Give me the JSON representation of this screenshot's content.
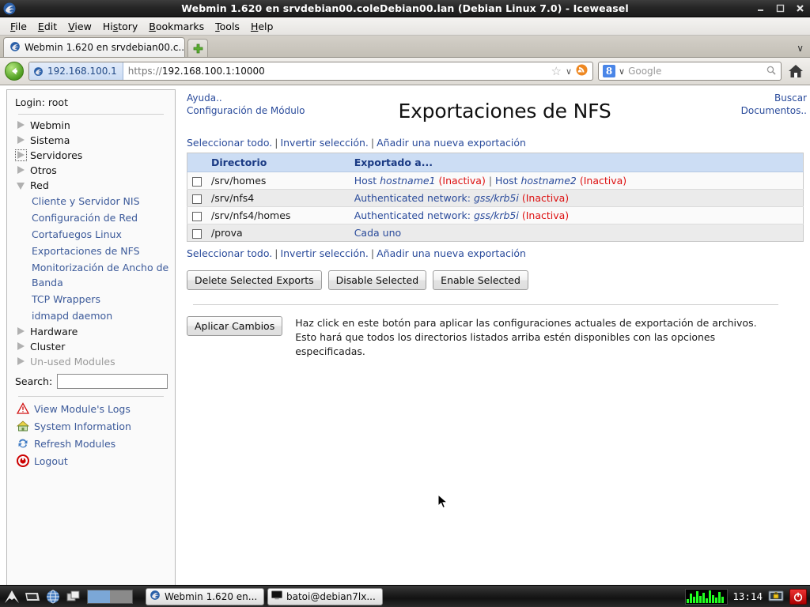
{
  "window": {
    "title": "Webmin 1.620 en srvdebian00.coleDebian00.lan (Debian Linux 7.0) - Iceweasel",
    "icon": "iceweasel-icon",
    "minimize_label": "Minimize",
    "restore_label": "Restore",
    "close_label": "Close"
  },
  "menubar": {
    "items": [
      {
        "label": "File"
      },
      {
        "label": "Edit"
      },
      {
        "label": "View"
      },
      {
        "label": "History"
      },
      {
        "label": "Bookmarks"
      },
      {
        "label": "Tools"
      },
      {
        "label": "Help"
      }
    ]
  },
  "tabs": {
    "items": [
      {
        "title": "Webmin 1.620 en srvdebian00.c..."
      }
    ],
    "new_tab_label": "+",
    "list_all_tabs": "∨"
  },
  "navbar": {
    "back_label": "Back",
    "identity_host": "192.168.100.1",
    "url_scheme": "https://",
    "url_rest": "192.168.100.1:10000",
    "bookmark_star": "☆",
    "dropdown_caret": "∨",
    "search_engine": "8",
    "search_placeholder": "Google",
    "home_label": "Home"
  },
  "sidebar": {
    "login_label": "Login: root",
    "categories": [
      {
        "label": "Webmin",
        "state": "collapsed",
        "focused": false,
        "dim": false
      },
      {
        "label": "Sistema",
        "state": "collapsed",
        "focused": false,
        "dim": false
      },
      {
        "label": "Servidores",
        "state": "collapsed",
        "focused": true,
        "dim": false
      },
      {
        "label": "Otros",
        "state": "collapsed",
        "focused": false,
        "dim": false
      },
      {
        "label": "Red",
        "state": "expanded",
        "focused": false,
        "dim": false
      }
    ],
    "red_modules": [
      {
        "label": "Cliente y Servidor NIS"
      },
      {
        "label": "Configuración de Red"
      },
      {
        "label": "Cortafuegos Linux"
      },
      {
        "label": "Exportaciones de NFS"
      },
      {
        "label": "Monitorización de Ancho de Banda"
      },
      {
        "label": "TCP Wrappers"
      },
      {
        "label": "idmapd daemon"
      }
    ],
    "categories_after": [
      {
        "label": "Hardware",
        "state": "collapsed",
        "dim": false
      },
      {
        "label": "Cluster",
        "state": "collapsed",
        "dim": false
      },
      {
        "label": "Un-used Modules",
        "state": "collapsed",
        "dim": true
      }
    ],
    "search_label": "Search:",
    "search_value": "",
    "actions": [
      {
        "label": "View Module's Logs",
        "icon": "warning-triangle-icon"
      },
      {
        "label": "System Information",
        "icon": "house-icon"
      },
      {
        "label": "Refresh Modules",
        "icon": "refresh-icon"
      },
      {
        "label": "Logout",
        "icon": "power-icon"
      }
    ]
  },
  "main": {
    "help_link": "Ayuda..",
    "module_config_link": "Configuración de Módulo",
    "search_docs_link_line1": "Buscar",
    "search_docs_link_line2": "Documentos..",
    "title": "Exportaciones de NFS",
    "actions": {
      "select_all": "Seleccionar todo.",
      "invert_selection": "Invertir selección.",
      "add_new_export": "Añadir una nueva exportación"
    },
    "table": {
      "headers": [
        "Directorio",
        "Exportado a..."
      ],
      "rows": [
        {
          "checked": false,
          "directory": "/srv/homes",
          "exported_to": [
            {
              "prefix": "Host ",
              "target": "hostname1",
              "status": "(Inactiva)"
            },
            {
              "prefix": "Host ",
              "target": "hostname2",
              "status": "(Inactiva)"
            }
          ]
        },
        {
          "checked": false,
          "directory": "/srv/nfs4",
          "exported_to": [
            {
              "prefix": "Authenticated network: ",
              "target": "gss/krb5i",
              "status": "(Inactiva)"
            }
          ]
        },
        {
          "checked": false,
          "directory": "/srv/nfs4/homes",
          "exported_to": [
            {
              "prefix": "Authenticated network: ",
              "target": "gss/krb5i",
              "status": "(Inactiva)"
            }
          ]
        },
        {
          "checked": false,
          "directory": "/prova",
          "exported_to": [
            {
              "prefix": "Cada uno",
              "target": "",
              "status": ""
            }
          ]
        }
      ]
    },
    "buttons": [
      {
        "label": "Delete Selected Exports"
      },
      {
        "label": "Disable Selected"
      },
      {
        "label": "Enable Selected"
      }
    ],
    "apply_button": "Aplicar Cambios",
    "apply_description": "Haz click en este botón para aplicar las configuraciones actuales de exportación de archivos. Esto hará que todos los directorios listados arriba estén disponibles con las opciones especificadas."
  },
  "taskbar": {
    "launchers": [
      {
        "icon": "show-desktop-icon"
      },
      {
        "icon": "terminal-icon"
      },
      {
        "icon": "browser-globe-icon"
      },
      {
        "icon": "windows-icon"
      }
    ],
    "workspaces": [
      {
        "active": true
      },
      {
        "active": false
      }
    ],
    "tasks": [
      {
        "label": "Webmin 1.620 en...",
        "icon": "iceweasel-icon",
        "active": true
      },
      {
        "label": "batoi@debian7lx...",
        "icon": "terminal-icon",
        "active": false
      }
    ],
    "tray": {
      "network_graph": "network-monitor-icon",
      "clock": "13:14",
      "lock_icon": "lock-screen-icon",
      "power_icon": "shutdown-icon"
    }
  },
  "colors": {
    "link": "#2a4b9b",
    "table_header_bg": "#ccddf4",
    "table_header_text": "#1b3b84",
    "inactive_red": "#dd1111",
    "row_odd": "#fafafa",
    "row_even": "#ebebeb"
  }
}
